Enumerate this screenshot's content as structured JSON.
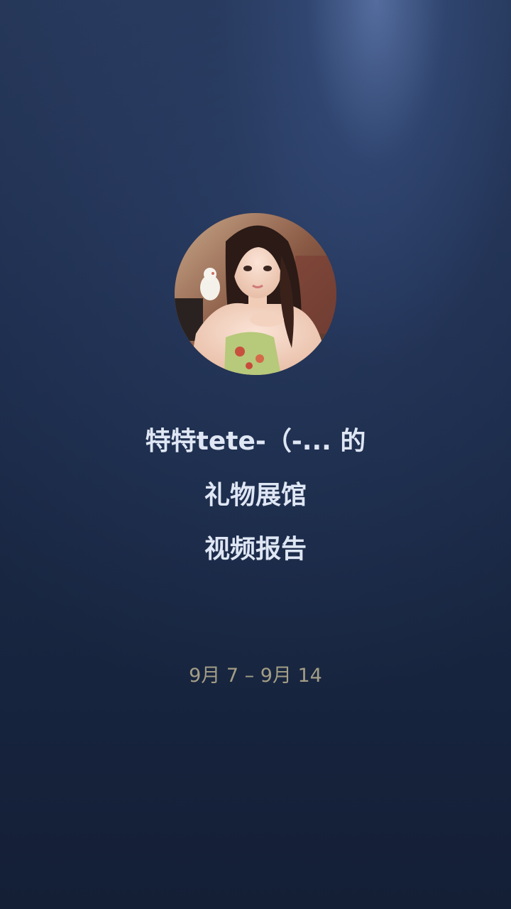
{
  "report": {
    "title_line1": "特特tete-（-... 的",
    "title_line2": "礼物展馆",
    "title_line3": "视频报告",
    "date_range": "9月 7 – 9月 14"
  },
  "colors": {
    "background_top": "#243556",
    "background_bottom": "#141f36",
    "title_text": "#dfe6f4",
    "date_text": "#a39e86"
  },
  "icons": {
    "avatar": "user-avatar-photo"
  }
}
